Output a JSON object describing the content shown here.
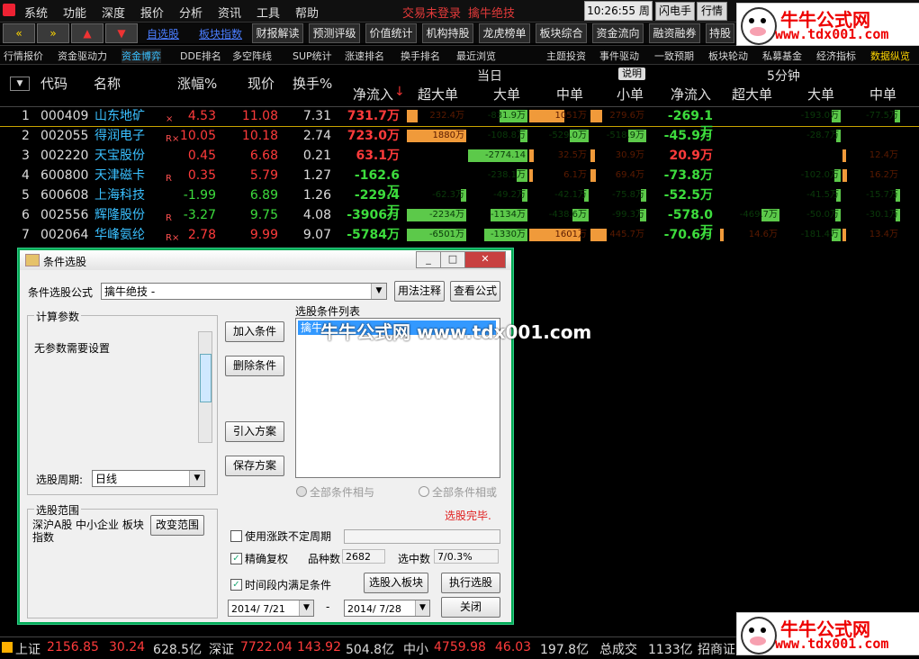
{
  "menu": [
    "系统",
    "功能",
    "深度",
    "报价",
    "分析",
    "资讯",
    "工具",
    "帮助"
  ],
  "status_login": "交易未登录",
  "status_formula": "擒牛绝技",
  "clock": "10:26:55 周一",
  "sys_buttons": [
    "闪电手",
    "行情"
  ],
  "toolbar": {
    "nav": [
      "«",
      "»",
      "▲",
      "▼"
    ],
    "links": [
      "自选股",
      "板块指数"
    ],
    "buttons": [
      "财报解读",
      "预测评级",
      "价值统计",
      "机构持股",
      "龙虎榜单",
      "板块综合",
      "资金流向",
      "融资融券",
      "持股"
    ]
  },
  "subtabs": [
    "行情报价",
    "资金驱动力",
    "资金博弈",
    "DDE排名",
    "多空阵线",
    "SUP统计",
    "涨速排名",
    "换手排名",
    "最近浏览",
    "主题投资",
    "事件驱动",
    "一致预期",
    "板块轮动",
    "私募基金",
    "经济指标",
    "数据纵览"
  ],
  "header": {
    "group_today": "当日",
    "explain": "说明",
    "group_5min": "5分钟",
    "cols": [
      "代码",
      "名称",
      "涨幅%",
      "现价",
      "换手%",
      "净流入",
      "超大单",
      "大单",
      "中单",
      "小单",
      "净流入",
      "超大单",
      "大单",
      "中单"
    ]
  },
  "rows": [
    {
      "no": "1",
      "code": "000409",
      "name": "山东地矿",
      "flag": "×",
      "chg": "4.53",
      "price": "11.08",
      "turnover": "7.31",
      "net": "731.7万",
      "xl": "232.4万",
      "l": "-831.9万",
      "m": "1051万",
      "s": "279.6万",
      "net5": "-269.1万",
      "l5": "-193.0万",
      "m5": "-77.5万"
    },
    {
      "no": "2",
      "code": "002055",
      "name": "得润电子",
      "flag": "R×",
      "chg": "10.05",
      "price": "10.18",
      "turnover": "2.74",
      "net": "723.0万",
      "xl": "1880万",
      "l": "-108.8万",
      "m": "-529.0万",
      "s": "-518.9万",
      "net5": "-45.9万",
      "l5": "-28.7万",
      "m5": ""
    },
    {
      "no": "3",
      "code": "002220",
      "name": "天宝股份",
      "flag": "",
      "chg": "0.45",
      "price": "6.68",
      "turnover": "0.21",
      "net": "63.1万",
      "xl": "",
      "l": "-2774.14",
      "m": "32.5万",
      "s": "30.9万",
      "net5": "20.9万",
      "l5": "",
      "m5": "12.4万"
    },
    {
      "no": "4",
      "code": "600800",
      "name": "天津磁卡",
      "flag": "R",
      "chg": "0.35",
      "price": "5.79",
      "turnover": "1.27",
      "net": "-162.6万",
      "xl": "",
      "l": "-238.1万",
      "m": "6.1万",
      "s": "69.4万",
      "net5": "-73.8万",
      "l5": "-102.0万",
      "m5": "16.2万"
    },
    {
      "no": "5",
      "code": "600608",
      "name": "上海科技",
      "flag": "",
      "chg": "-1.99",
      "price": "6.89",
      "turnover": "1.26",
      "net": "-229.4万",
      "xl": "-62.3万",
      "l": "-49.2万",
      "m": "-42.1万",
      "s": "-75.8万",
      "net5": "-52.5万",
      "l5": "-41.5万",
      "m5": "-15.7万"
    },
    {
      "no": "6",
      "code": "002556",
      "name": "辉隆股份",
      "flag": "R",
      "chg": "-3.27",
      "price": "9.75",
      "turnover": "4.08",
      "net": "-3906万",
      "xl": "-2234万",
      "l": "-1134万",
      "m": "-438.6万",
      "s": "-99.3万",
      "net5": "-578.0万",
      "xl5": "-469.7万",
      "l5": "-50.0万",
      "m5": "-30.1万"
    },
    {
      "no": "7",
      "code": "002064",
      "name": "华峰氨纶",
      "flag": "R×",
      "chg": "2.78",
      "price": "9.99",
      "turnover": "9.07",
      "net": "-5784万",
      "xl": "-6501万",
      "l": "-1330万",
      "m": "1601万",
      "s": "445.7万",
      "net5": "-70.6万",
      "xl5": "14.6万",
      "l5": "-181.4万",
      "m5": "13.4万"
    }
  ],
  "dialog": {
    "title": "条件选股",
    "formula_label": "条件选股公式",
    "formula_value": "擒牛绝技 -",
    "btn_usage": "用法注释",
    "btn_view": "查看公式",
    "params_legend": "计算参数",
    "params_text": "无参数需要设置",
    "period_label": "选股周期:",
    "period_value": "日线",
    "scope_legend": "选股范围",
    "scope_text": "深沪A股 中小企业 板块指数",
    "btn_scope": "改变范围",
    "btn_add": "加入条件",
    "btn_delete": "删除条件",
    "btn_import": "引入方案",
    "btn_save": "保存方案",
    "list_label": "选股条件列表",
    "list_item": "擒牛",
    "radio_and": "全部条件相与",
    "radio_or": "全部条件相或",
    "done": "选股完毕.",
    "chk_period": "使用涨跌不定周期",
    "chk_adjust": "精确复权",
    "count_label": "品种数",
    "count_value": "2682",
    "selected_label": "选中数",
    "selected_value": "7/0.3%",
    "chk_range": "时间段内满足条件",
    "btn_to_block": "选股入板块",
    "btn_execute": "执行选股",
    "date_from": "2014/ 7/21",
    "date_sep": "-",
    "date_to": "2014/ 7/28",
    "btn_close": "关闭"
  },
  "watermark_overlay": "牛牛公式网 www.tdx001.com",
  "watermark": {
    "title": "牛牛公式网",
    "url": "www.tdx001.com"
  },
  "footer": {
    "sh_label": "上证",
    "sh_val": "2156.85",
    "sh_chg": "30.24",
    "sh_amt": "628.5亿",
    "sz_label": "深证",
    "sz_val": "7722.04",
    "sz_chg": "143.92",
    "sz_amt": "504.8亿",
    "zx_label": "中小",
    "zx_val": "4759.98",
    "zx_chg": "46.03",
    "zx_amt": "197.8亿",
    "total_label": "总成交",
    "total_val": "1133亿",
    "broker": "招商证"
  },
  "colors": {
    "up": "#ff3b3b",
    "down": "#3ddc3d",
    "cyan": "#3ac0ff",
    "yellow": "#ffd700",
    "bar_green": "#5cc94a",
    "bar_orange": "#f09a3a"
  }
}
